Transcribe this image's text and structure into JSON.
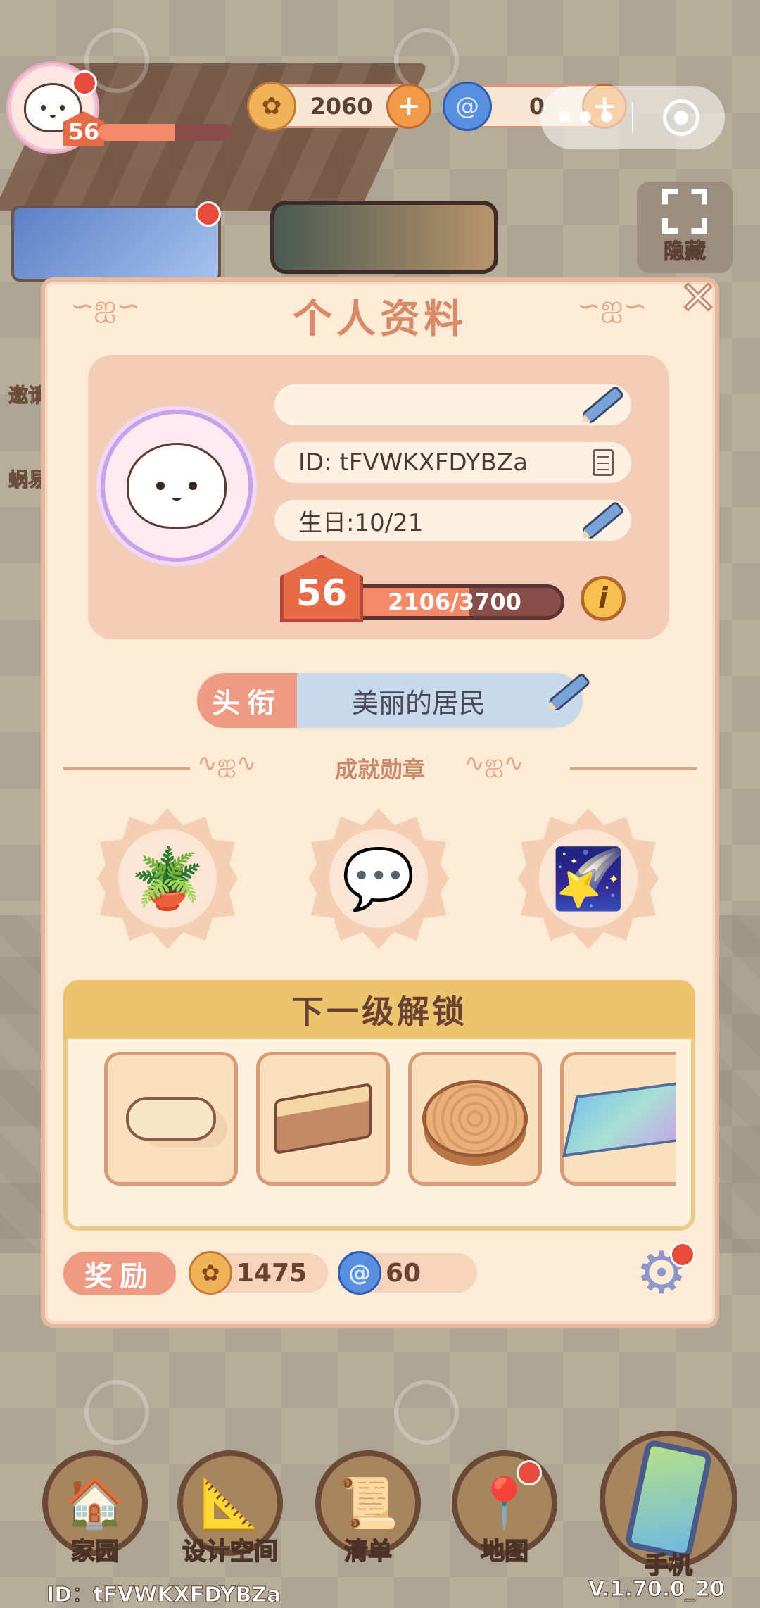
{
  "hud": {
    "level": "56",
    "level_progress": 0.57,
    "coins": "2060",
    "gems": "0",
    "capsule_more": "•••",
    "hide_label": "隐藏",
    "side_invite": "邀请",
    "side_snail": "蜗易"
  },
  "dialog": {
    "title": "个人资料",
    "close_glyph": "✕",
    "name_value": "",
    "id_text": "ID: tFVWKXFDYBZa",
    "birthday_text": "生日:10/21",
    "level": "56",
    "xp_text": "2106/3700",
    "xp_progress": 0.569,
    "info_glyph": "i",
    "title_tag": "头衔",
    "title_value": "美丽的居民",
    "achievements_label": "成就勋章",
    "medals": [
      {
        "icon": "watering-can-icon",
        "glyph": "🪴"
      },
      {
        "icon": "heart-chat-icon",
        "glyph": "💬"
      },
      {
        "icon": "rainbow-star-icon",
        "glyph": "🌠"
      }
    ],
    "unlock_title": "下一级解锁",
    "unlock_items": [
      {
        "icon": "slippers-icon"
      },
      {
        "icon": "bed-icon"
      },
      {
        "icon": "stump-table-icon"
      },
      {
        "icon": "rug-icon"
      }
    ],
    "reward_tag": "奖励",
    "reward_coins": "1475",
    "reward_gems": "60"
  },
  "nav": {
    "home": "家园",
    "design": "设计空间",
    "list": "清单",
    "map": "地图",
    "phone": "手机"
  },
  "footer": {
    "id": "ID：tFVWKXFDYBZa",
    "version": "V.1.70.0_20"
  },
  "colors": {
    "accent": "#e86b48",
    "dialog_bg": "#fcebd7",
    "title_tag": "#ee9a84",
    "gold": "#edc46e"
  }
}
